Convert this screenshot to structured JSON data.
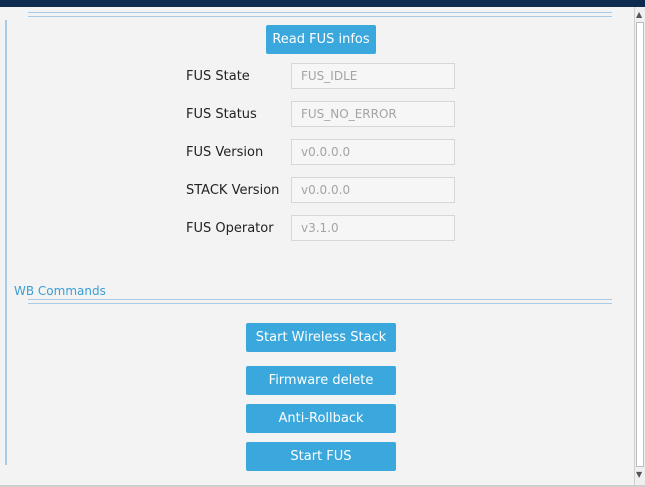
{
  "fus_panel": {
    "read_button_label": "Read FUS infos",
    "fields": [
      {
        "label": "FUS State",
        "value": "FUS_IDLE"
      },
      {
        "label": "FUS Status",
        "value": "FUS_NO_ERROR"
      },
      {
        "label": "FUS Version",
        "value": "v0.0.0.0"
      },
      {
        "label": "STACK Version",
        "value": "v0.0.0.0"
      },
      {
        "label": "FUS Operator",
        "value": "v3.1.0"
      }
    ]
  },
  "wb_commands": {
    "title": "WB Commands",
    "buttons": {
      "start_wireless_stack": "Start Wireless Stack",
      "firmware_delete": "Firmware delete",
      "anti_rollback": "Anti-Rollback",
      "start_fus": "Start FUS"
    }
  },
  "colors": {
    "accent": "#3aa8dd",
    "header": "#0d2a4f",
    "divider": "#a9cbe6"
  }
}
